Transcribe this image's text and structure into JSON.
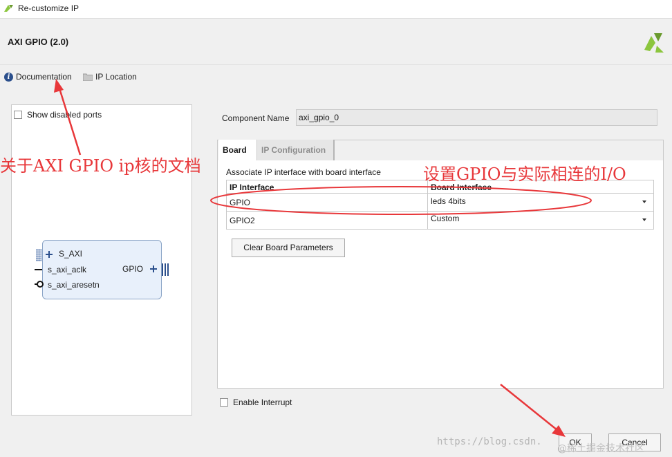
{
  "window": {
    "title": "Re-customize IP"
  },
  "header": {
    "ip_name": "AXI GPIO (2.0)"
  },
  "links": {
    "documentation": "Documentation",
    "ip_location": "IP Location"
  },
  "left_panel": {
    "show_disabled_ports": "Show disabled ports",
    "block": {
      "bus_port": "S_AXI",
      "ports": [
        "s_axi_aclk",
        "s_axi_aresetn"
      ],
      "output_port": "GPIO"
    }
  },
  "component": {
    "label": "Component Name",
    "value": "axi_gpio_0"
  },
  "tabs": [
    {
      "label": "Board",
      "active": true
    },
    {
      "label": "IP Configuration",
      "active": false
    }
  ],
  "board": {
    "associate_text": "Associate IP interface with board interface",
    "columns": [
      "IP Interface",
      "Board Interface"
    ],
    "rows": [
      {
        "ip_interface": "GPIO",
        "board_interface": "leds 4bits"
      },
      {
        "ip_interface": "GPIO2",
        "board_interface": "Custom"
      }
    ],
    "clear_button": "Clear Board Parameters"
  },
  "enable_interrupt": "Enable Interrupt",
  "footer": {
    "ok": "OK",
    "cancel": "Cancel"
  },
  "annotations": {
    "doc_note": "关于AXI GPIO ip核的文档",
    "gpio_note": "设置GPIO与实际相连的I/O"
  },
  "watermark": {
    "url": "https://blog.csdn.",
    "community": "@稀土掘金技术社区"
  },
  "colors": {
    "annotation": "#e8373a",
    "brand_green": "#8cc63e"
  }
}
